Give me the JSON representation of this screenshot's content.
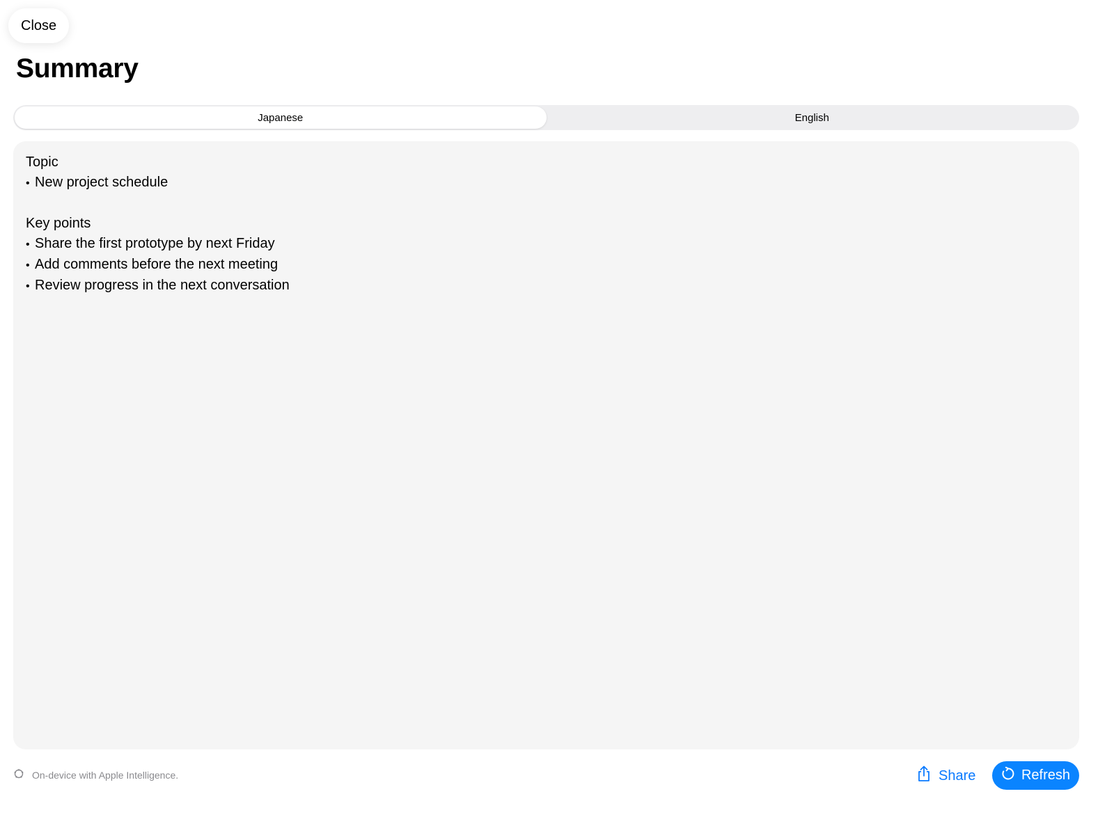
{
  "header": {
    "close_label": "Close",
    "title": "Summary"
  },
  "tabs": [
    {
      "label": "Japanese",
      "selected": true
    },
    {
      "label": "English",
      "selected": false
    }
  ],
  "summary": {
    "topic_heading": "Topic",
    "topic_items": [
      "New project schedule"
    ],
    "key_points_heading": "Key points",
    "key_points": [
      "Share the first prototype by next Friday",
      "Add comments before the next meeting",
      "Review progress in the next conversation"
    ],
    "bullet": "•"
  },
  "footer": {
    "note": "On-device with Apple Intelligence.",
    "note_icon": "apple-intelligence-icon",
    "share_label": "Share",
    "share_icon": "share-icon",
    "refresh_label": "Refresh",
    "refresh_icon": "refresh-icon"
  },
  "colors": {
    "accent": "#0A84FF",
    "accent_text": "#0A7AFF",
    "card_background": "#F5F5F5",
    "segment_track": "#EEEEF0",
    "muted_text": "#8A8A8E"
  }
}
